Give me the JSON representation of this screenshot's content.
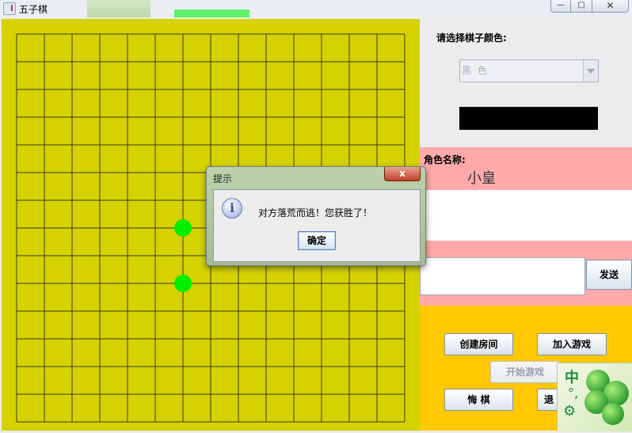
{
  "window": {
    "title": "五子棋",
    "min": "—",
    "max": "▢",
    "close": "✕"
  },
  "board": {
    "background": "#d5d200",
    "grid_lines": 15,
    "stones": [
      {
        "row": 7,
        "col": 6,
        "color": "green"
      },
      {
        "row": 9,
        "col": 6,
        "color": "green"
      }
    ]
  },
  "sidebar": {
    "color_prompt": "请选择棋子颜色:",
    "color_select_value": "黑  色",
    "role_label": "角色名称:",
    "role_name": "小皇",
    "send_label": "发送"
  },
  "controls": {
    "create_room": "创建房间",
    "join_game": "加入游戏",
    "start_game": "开始游戏",
    "undo": "悔  棋",
    "exit_partial": "退"
  },
  "ime": {
    "lang": "中",
    "punct": "°,",
    "gear_icon": "⚙"
  },
  "dialog": {
    "title": "提示",
    "close": "x",
    "message": "对方落荒而逃！您获胜了！",
    "ok_label": "确定",
    "icon": "i"
  }
}
